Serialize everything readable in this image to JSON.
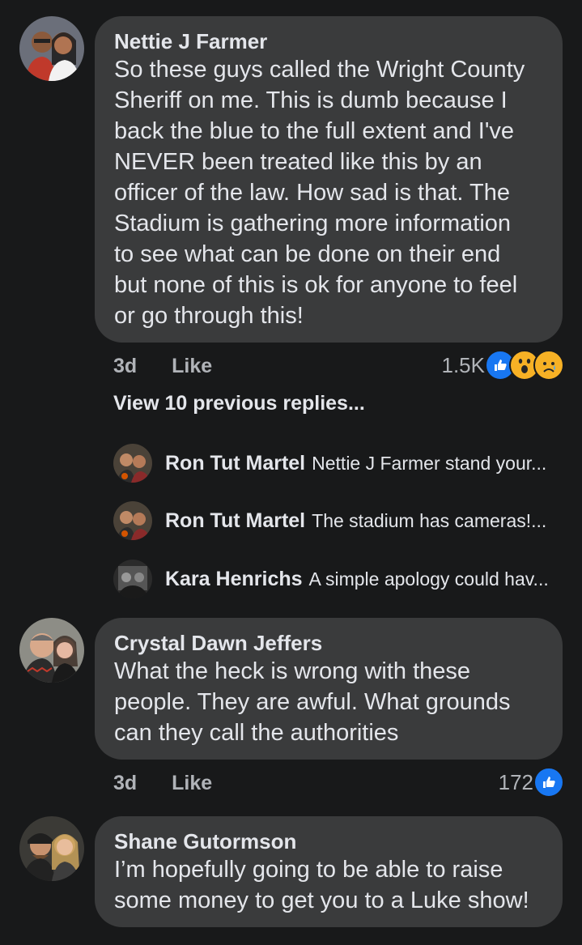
{
  "comments": [
    {
      "author": "Nettie J Farmer",
      "lines": [
        "So these guys called the Wright County",
        "Sheriff on me. This is dumb because I",
        "back the blue to the full extent and I've",
        "NEVER been treated like this by an",
        "officer of the law. How sad is that. The",
        "Stadium is gathering more information",
        "to see what can be done on their end",
        "but none of this is ok for anyone to feel",
        "or go through this!"
      ],
      "time": "3d",
      "like_label": "Like",
      "reaction_count": "1.5K",
      "reactions": [
        "like-reaction-icon",
        "wow-reaction-icon",
        "sad-reaction-icon"
      ]
    },
    {
      "author": "Crystal Dawn Jeffers",
      "lines": [
        "What the heck is wrong with these",
        "people.  They are awful. What grounds",
        "can they call the authorities"
      ],
      "time": "3d",
      "like_label": "Like",
      "reaction_count": "172",
      "reactions": [
        "like-reaction-icon"
      ]
    },
    {
      "author": "Shane Gutormson",
      "lines": [
        "I’m hopefully going to be able to raise",
        "some money to get you to a Luke show!"
      ]
    }
  ],
  "view_previous": "View 10 previous replies...",
  "replies": [
    {
      "author": "Ron Tut Martel",
      "text": "Nettie J Farmer stand your..."
    },
    {
      "author": "Ron Tut Martel",
      "text": "The stadium has cameras!..."
    },
    {
      "author": "Kara Henrichs",
      "text": "A simple apology could hav..."
    }
  ],
  "colors": {
    "background": "#18191a",
    "bubble": "#3a3b3c",
    "primary_text": "#e4e6eb",
    "secondary_text": "#b0b3b8",
    "like_blue": "#1877f2",
    "wow_yellow": "#f7b125"
  }
}
